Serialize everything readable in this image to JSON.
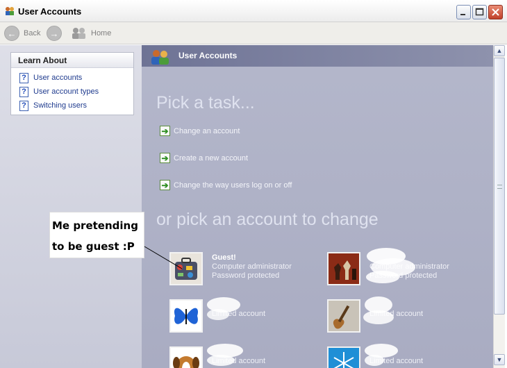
{
  "window": {
    "title": "User Accounts"
  },
  "nav": {
    "back_label": "Back",
    "home_label": "Home"
  },
  "learn_about": {
    "heading": "Learn About",
    "items": [
      {
        "label": "User accounts"
      },
      {
        "label": "User account types"
      },
      {
        "label": "Switching users"
      }
    ]
  },
  "main": {
    "header_title": "User Accounts",
    "pick_task_title": "Pick a task...",
    "tasks": [
      {
        "label": "Change an account"
      },
      {
        "label": "Create a new account"
      },
      {
        "label": "Change the way users log on or off"
      }
    ],
    "pick_account_title": "or pick an account to change",
    "accounts": [
      {
        "name": "Guest!",
        "type": "Computer administrator",
        "status": "Password protected",
        "picture": "suitcase"
      },
      {
        "name": "",
        "type": "Computer administrator",
        "status": "Password protected",
        "picture": "chess"
      },
      {
        "name": "",
        "type": "Limited account",
        "status": "",
        "picture": "butterfly"
      },
      {
        "name": "",
        "type": "Limited account",
        "status": "",
        "picture": "guitar"
      },
      {
        "name": "",
        "type": "Limited account",
        "status": "",
        "picture": "dog"
      },
      {
        "name": "",
        "type": "Limited account",
        "status": "",
        "picture": "snowflake"
      }
    ]
  },
  "annotation": {
    "line1": "Me pretending",
    "line2": "to be guest :P"
  },
  "colors": {
    "accent_header": "#6e7395",
    "task_arrow": "#2f8f22",
    "close_button": "#c0412a"
  }
}
